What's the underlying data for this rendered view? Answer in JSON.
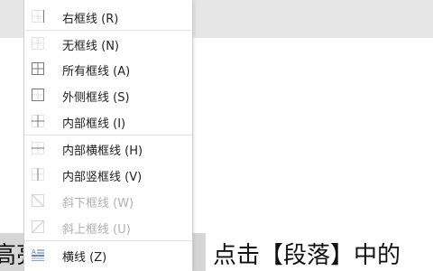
{
  "menu": {
    "items": [
      {
        "label": "右框线 (R)",
        "icon": "border-right-icon",
        "enabled": true
      },
      {
        "label": "无框线 (N)",
        "icon": "border-none-icon",
        "enabled": true
      },
      {
        "label": "所有框线 (A)",
        "icon": "border-all-icon",
        "enabled": true
      },
      {
        "label": "外侧框线 (S)",
        "icon": "border-outside-icon",
        "enabled": true
      },
      {
        "label": "内部框线 (I)",
        "icon": "border-inside-icon",
        "enabled": true
      },
      {
        "label": "内部横框线 (H)",
        "icon": "border-inside-horizontal-icon",
        "enabled": true
      },
      {
        "label": "内部竖框线 (V)",
        "icon": "border-inside-vertical-icon",
        "enabled": true
      },
      {
        "label": "斜下框线 (W)",
        "icon": "border-diagonal-down-icon",
        "enabled": false
      },
      {
        "label": "斜上框线 (U)",
        "icon": "border-diagonal-up-icon",
        "enabled": false
      },
      {
        "label": "横线 (Z)",
        "icon": "horizontal-line-icon",
        "enabled": true
      }
    ]
  },
  "document": {
    "text_left": "高亮",
    "text_right": "点击【段落】中的"
  },
  "colors": {
    "icon": "#7a7a7a",
    "icon_dim": "#c9c9c9",
    "label_disabled": "#b0b0b0"
  }
}
